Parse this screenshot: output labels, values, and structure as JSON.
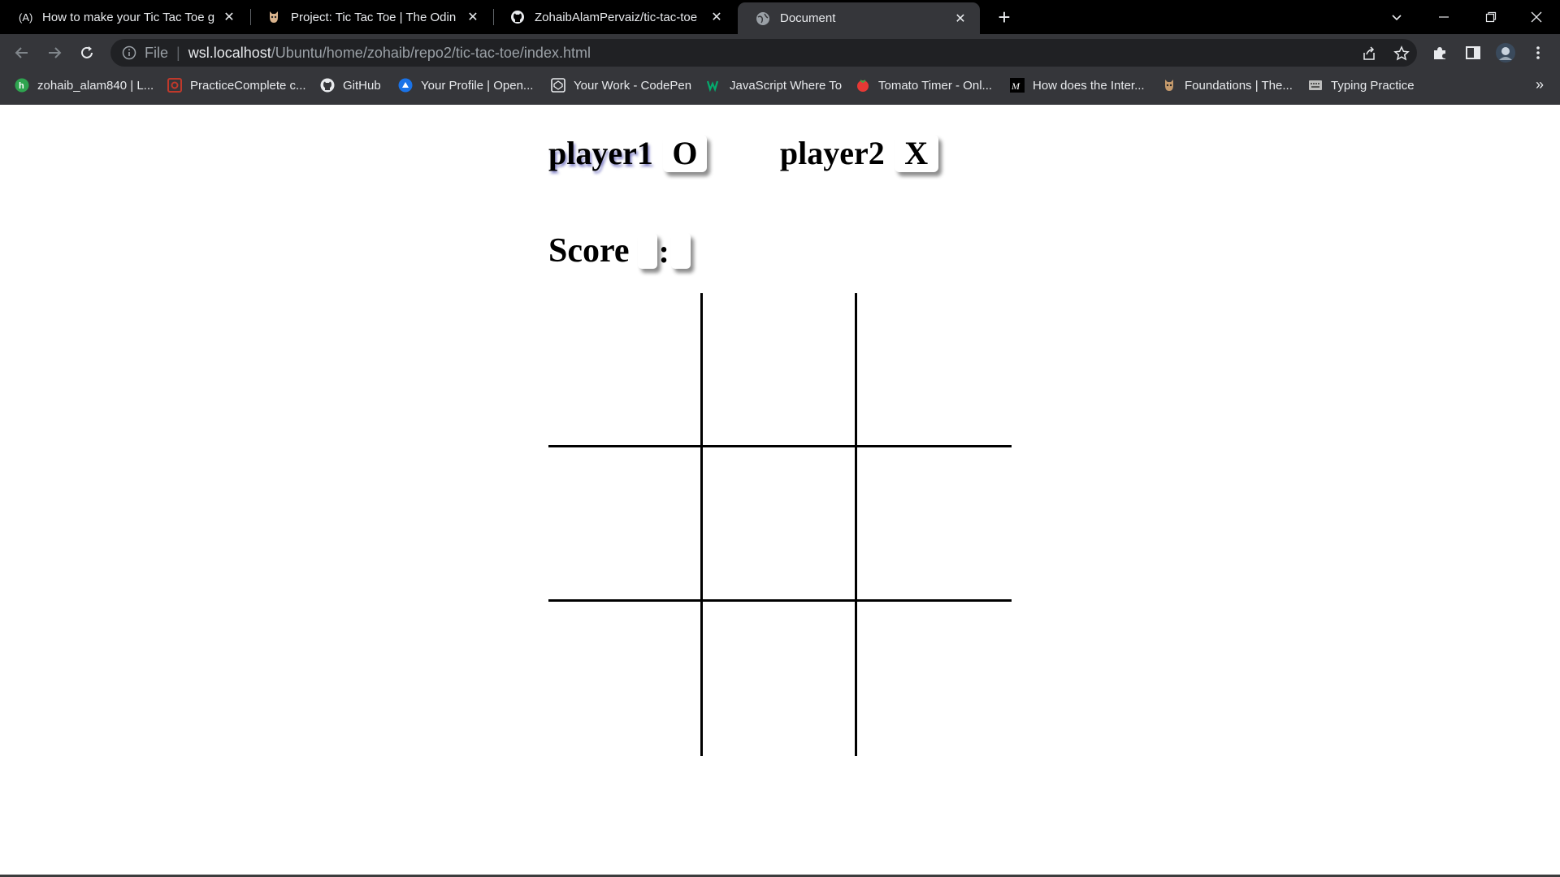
{
  "tabs": [
    {
      "title": "How to make your Tic Tac Toe ga",
      "icon": "angular-a-icon",
      "active": false
    },
    {
      "title": "Project: Tic Tac Toe | The Odin Pro",
      "icon": "odin-icon",
      "active": false
    },
    {
      "title": "ZohaibAlamPervaiz/tic-tac-toe",
      "icon": "github-icon",
      "active": false
    },
    {
      "title": "Document",
      "icon": "globe-icon",
      "active": true
    }
  ],
  "address": {
    "scheme_label": "File",
    "host": "wsl.localhost",
    "path": "/Ubuntu/home/zohaib/repo2/tic-tac-toe/index.html"
  },
  "bookmarks": [
    {
      "label": "zohaib_alam840 | L...",
      "icon": "leetcode-icon",
      "color": "#2ea44f"
    },
    {
      "label": "PracticeComplete c...",
      "icon": "practice-icon",
      "color": "#c0392b"
    },
    {
      "label": "GitHub",
      "icon": "github-icon",
      "color": "#ffffff"
    },
    {
      "label": "Your Profile | Open...",
      "icon": "profile-icon",
      "color": "#1a73e8"
    },
    {
      "label": "Your Work - CodePen",
      "icon": "codepen-icon",
      "color": "#ffffff"
    },
    {
      "label": "JavaScript Where To",
      "icon": "w3schools-icon",
      "color": "#04aa6d"
    },
    {
      "label": "Tomato Timer - Onl...",
      "icon": "tomato-icon",
      "color": "#e53935"
    },
    {
      "label": "How does the Inter...",
      "icon": "medium-icon",
      "color": "#ffffff"
    },
    {
      "label": "Foundations | The...",
      "icon": "odin-icon",
      "color": "#c49a6c"
    },
    {
      "label": "Typing Practice",
      "icon": "typing-icon",
      "color": "#bdbdbd"
    }
  ],
  "game": {
    "player1": {
      "name": "player1",
      "mark": "O"
    },
    "player2": {
      "name": "player2",
      "mark": "X"
    },
    "score": {
      "label": "Score",
      "separator": ":",
      "player1": "",
      "player2": ""
    },
    "board": [
      "",
      "",
      "",
      "",
      "",
      "",
      "",
      "",
      ""
    ]
  },
  "colors": {
    "tabbar": "#000000",
    "toolbar": "#35363a",
    "omnibox": "#202124",
    "page_bg": "#ffffff",
    "player_name_shadow": "#2828a0"
  }
}
